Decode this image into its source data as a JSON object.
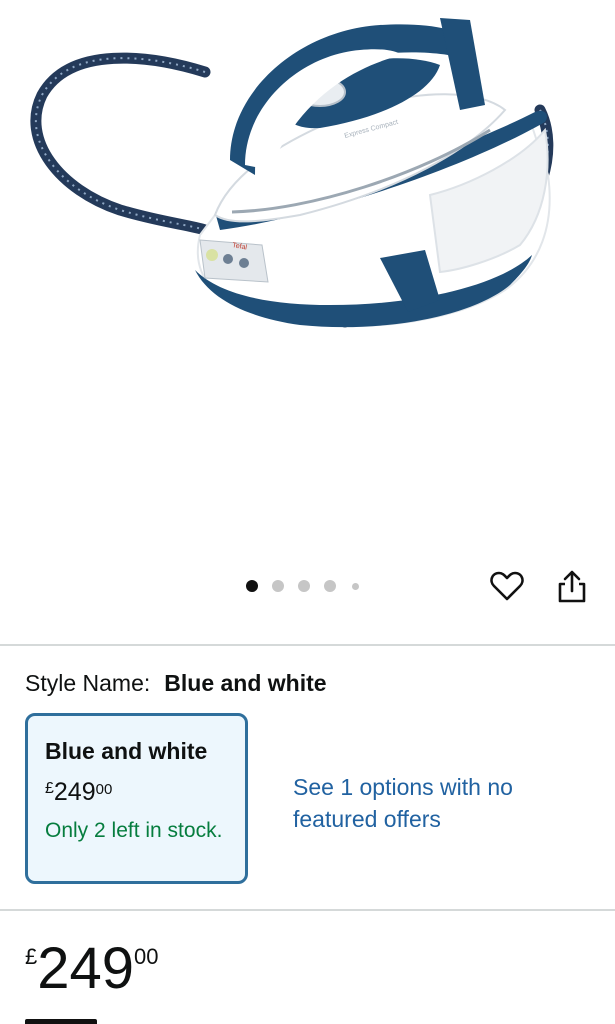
{
  "gallery": {
    "product_image": "steam-generator-iron",
    "brand_text": "Tefal",
    "model_text": "Express Compact",
    "image_count_dots": 5,
    "active_index": 0
  },
  "actions": {
    "wishlist_icon": "heart-icon",
    "share_icon": "share-icon"
  },
  "style": {
    "label": "Style Name:",
    "value": "Blue and white",
    "option": {
      "title": "Blue and white",
      "currency": "£",
      "price_whole": "249",
      "price_fraction": "00",
      "stock_text": "Only 2 left in stock."
    },
    "more_options": "See 1 options with no featured offers"
  },
  "price": {
    "currency": "£",
    "whole": "249",
    "fraction": "00"
  },
  "colors": {
    "brand_blue": "#1f4f78",
    "card_border": "#2f6f9c",
    "card_bg": "#edf7fd",
    "link": "#2162a1",
    "stock_green": "#067d3e"
  }
}
